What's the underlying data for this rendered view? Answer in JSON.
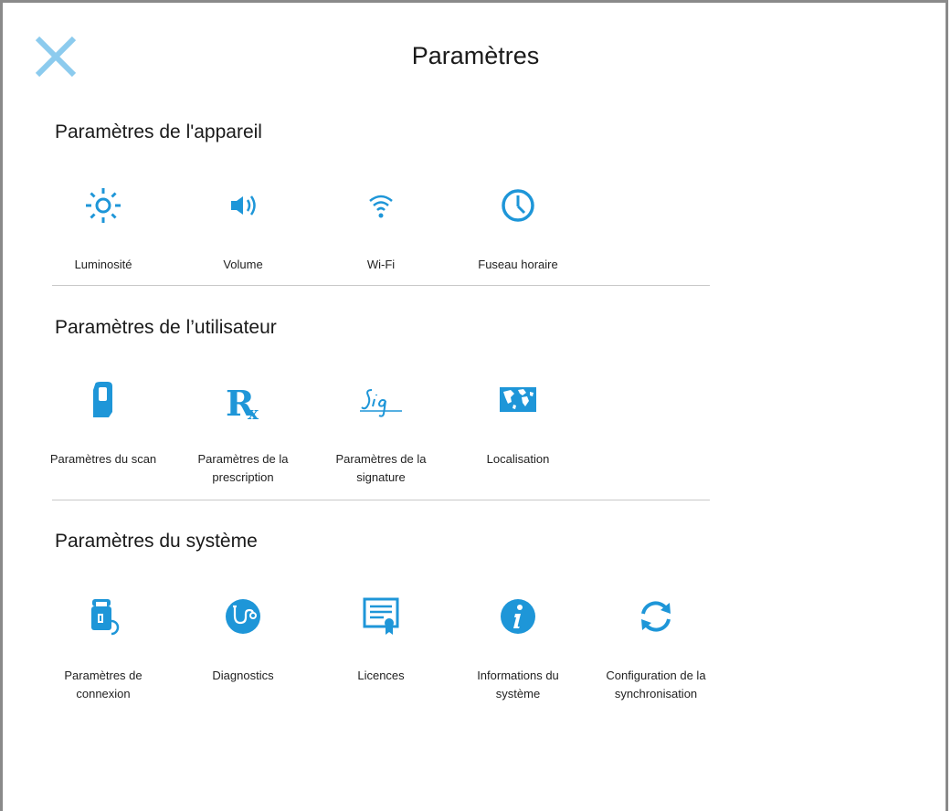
{
  "header": {
    "title": "Paramètres"
  },
  "sections": [
    {
      "title": "Paramètres de l'appareil",
      "items": [
        {
          "label": "Luminosité",
          "icon": "brightness-icon"
        },
        {
          "label": "Volume",
          "icon": "volume-icon"
        },
        {
          "label": "Wi-Fi",
          "icon": "wifi-icon"
        },
        {
          "label": "Fuseau horaire",
          "icon": "clock-icon"
        }
      ]
    },
    {
      "title": "Paramètres de l’utilisateur",
      "items": [
        {
          "label": "Paramètres du scan",
          "icon": "scanner-icon"
        },
        {
          "label": "Paramètres de la prescription",
          "icon": "rx-icon"
        },
        {
          "label": "Paramètres de la signature",
          "icon": "signature-icon"
        },
        {
          "label": "Localisation",
          "icon": "world-map-icon"
        }
      ]
    },
    {
      "title": "Paramètres du système",
      "items": [
        {
          "label": "Paramètres de connexion",
          "icon": "lock-icon"
        },
        {
          "label": "Diagnostics",
          "icon": "stethoscope-icon"
        },
        {
          "label": "Licences",
          "icon": "certificate-icon"
        },
        {
          "label": "Informations du système",
          "icon": "info-icon"
        },
        {
          "label": "Configuration de la synchronisation",
          "icon": "sync-icon"
        }
      ]
    }
  ],
  "colors": {
    "accent": "#1e96d8",
    "close": "#8ccbee",
    "divider": "#c8c8c8",
    "border": "#8a8a8a"
  }
}
